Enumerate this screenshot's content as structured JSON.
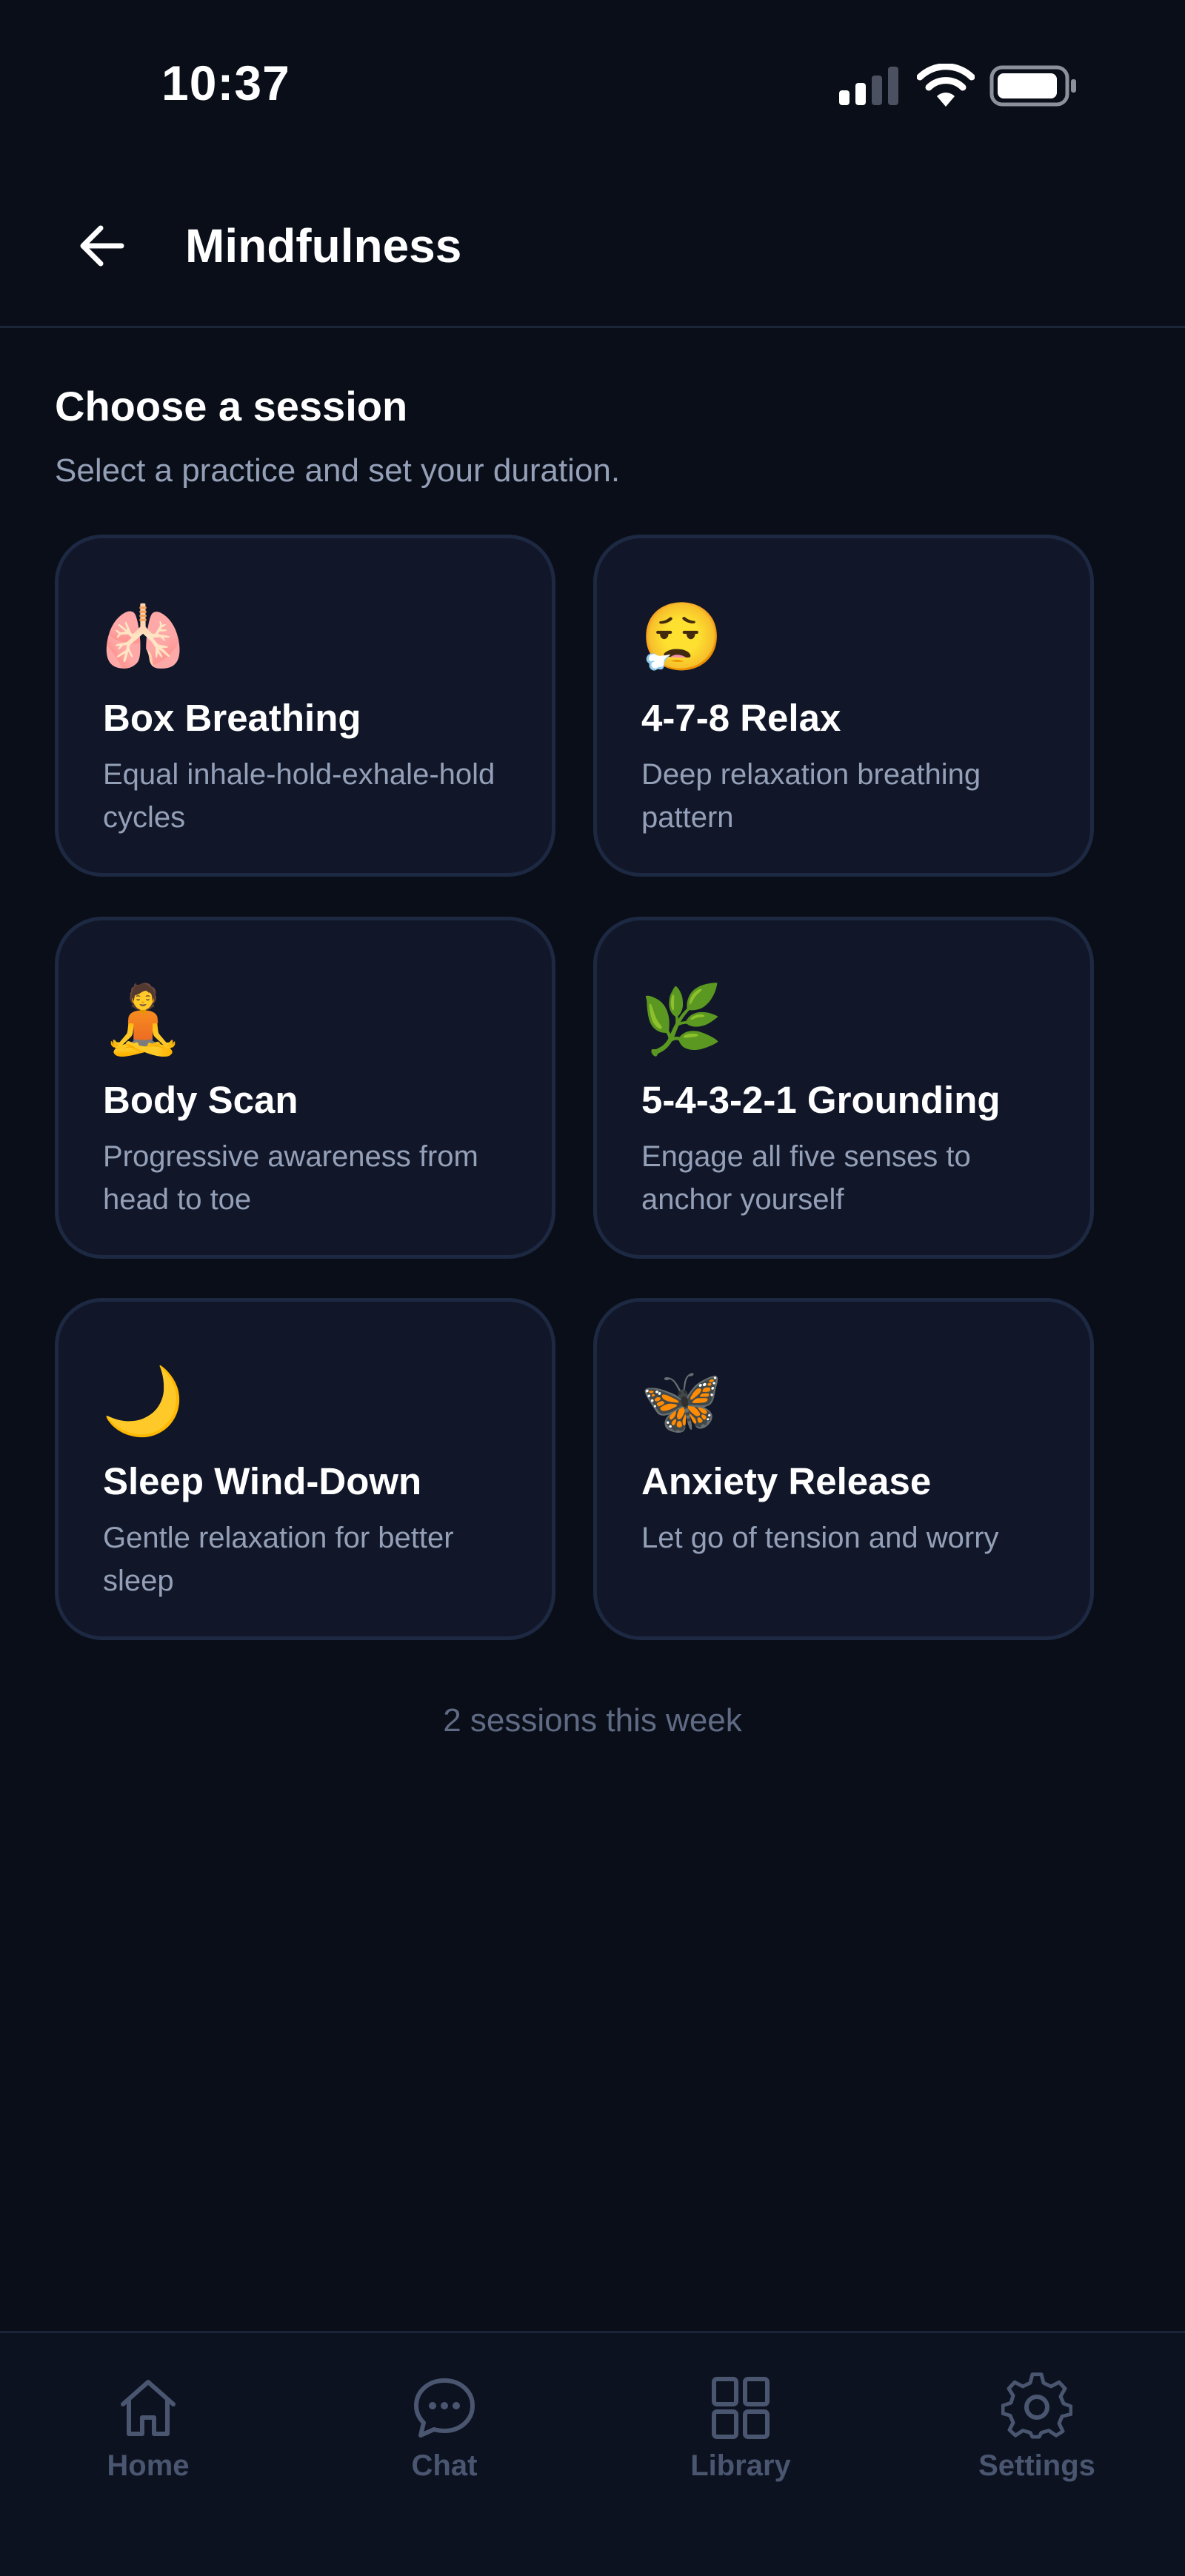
{
  "status_bar": {
    "time": "10:37"
  },
  "header": {
    "title": "Mindfulness",
    "back_icon": "arrow-left-icon"
  },
  "section": {
    "heading": "Choose a session",
    "subtitle": "Select a practice and set your duration."
  },
  "sessions": [
    {
      "emoji": "🫁",
      "icon": "lungs-icon",
      "title": "Box Breathing",
      "description": "Equal inhale-hold-exhale-hold cycles"
    },
    {
      "emoji": "😮‍💨",
      "icon": "exhale-face-icon",
      "title": "4-7-8 Relax",
      "description": "Deep relaxation breathing pattern"
    },
    {
      "emoji": "🧘",
      "icon": "meditation-icon",
      "title": "Body Scan",
      "description": "Progressive awareness from head to toe"
    },
    {
      "emoji": "🌿",
      "icon": "herb-icon",
      "title": "5-4-3-2-1 Grounding",
      "description": "Engage all five senses to anchor yourself"
    },
    {
      "emoji": "🌙",
      "icon": "crescent-moon-icon",
      "title": "Sleep Wind-Down",
      "description": "Gentle relaxation for better sleep"
    },
    {
      "emoji": "🦋",
      "icon": "butterfly-icon",
      "title": "Anxiety Release",
      "description": "Let go of tension and worry"
    }
  ],
  "footer_note": "2 sessions this week",
  "bottom_nav": {
    "items": [
      {
        "label": "Home",
        "icon": "home-icon"
      },
      {
        "label": "Chat",
        "icon": "chat-bubble-icon"
      },
      {
        "label": "Library",
        "icon": "grid-icon"
      },
      {
        "label": "Settings",
        "icon": "gear-icon"
      }
    ]
  },
  "colors": {
    "background": "#0a0e18",
    "card_background": "#111729",
    "card_border": "#1d2942",
    "text_primary": "#ffffff",
    "text_secondary": "#94a0b8",
    "text_muted": "#5f6b85",
    "nav_inactive": "#4a5670"
  }
}
